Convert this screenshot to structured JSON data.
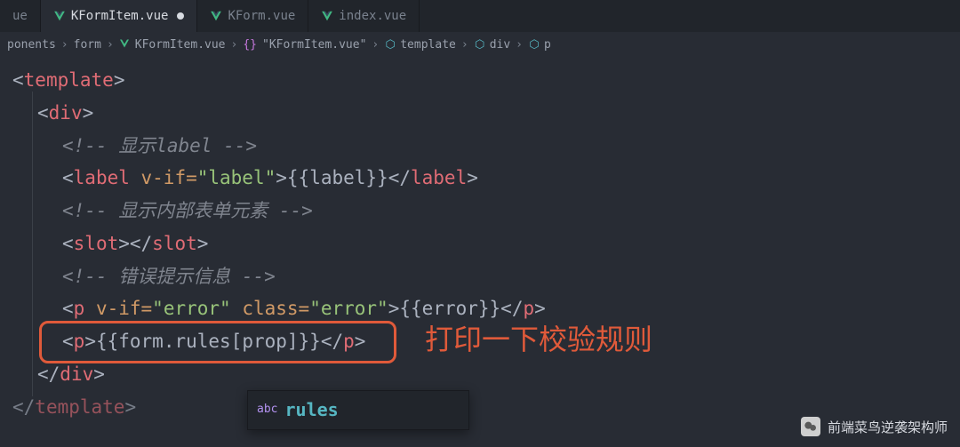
{
  "tabs": [
    {
      "label": "ue",
      "active": false
    },
    {
      "label": "KFormItem.vue",
      "active": true,
      "modified": true
    },
    {
      "label": "KForm.vue",
      "active": false
    },
    {
      "label": "index.vue",
      "active": false
    }
  ],
  "breadcrumbs": {
    "parts": [
      {
        "text": "ponents",
        "icon": ""
      },
      {
        "text": "form",
        "icon": ""
      },
      {
        "text": "KFormItem.vue",
        "icon": "vue"
      },
      {
        "text": "{}",
        "icon": ""
      },
      {
        "text": "\"KFormItem.vue\"",
        "icon": ""
      },
      {
        "text": "template",
        "icon": "cube"
      },
      {
        "text": "div",
        "icon": "cube"
      },
      {
        "text": "p",
        "icon": "cube"
      }
    ]
  },
  "code": {
    "l1": "<template>",
    "l2": "<div>",
    "l3_open": "<!-- ",
    "l3_text": "显示label",
    "l3_close": " -->",
    "l4_tag_open": "<label",
    "l4_attr": " v-if=",
    "l4_val": "\"label\"",
    "l4_close1": ">",
    "l4_expr": "{{label}}",
    "l4_close2": "</label>",
    "l5_open": "<!-- ",
    "l5_text": "显示内部表单元素",
    "l5_close": " -->",
    "l6": "<slot></slot>",
    "l7_open": "<!-- ",
    "l7_text": "错误提示信息",
    "l7_close": " -->",
    "l8_tag": "<p",
    "l8_attr1": " v-if=",
    "l8_val1": "\"error\"",
    "l8_attr2": " class=",
    "l8_val2": "\"error\"",
    "l8_close1": ">",
    "l8_expr": "{{error}}",
    "l8_close2": "</p>",
    "l9_tag": "<p>",
    "l9_expr": "{{form.rules[prop]}}",
    "l9_close": "</p>",
    "l10": "</div>",
    "l11": "</template>"
  },
  "annotation": "打印一下校验规则",
  "autocomplete": {
    "badge": "abc",
    "item": "rules"
  },
  "watermark": "前端菜鸟逆袭架构师"
}
